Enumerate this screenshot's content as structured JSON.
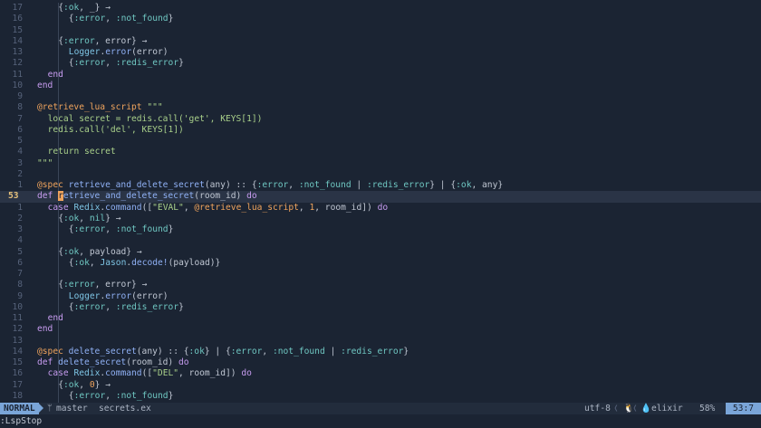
{
  "colors": {
    "background": "#1b2433",
    "current_line": "#2a3446",
    "mode_badge": "#7aa5d8",
    "keyword": "#c79cf0",
    "atom": "#6fc7c2",
    "string": "#a9d08a",
    "function": "#8fb0f4"
  },
  "lines": [
    {
      "n": "17",
      "indent": 2,
      "tokens": [
        [
          "op",
          "{"
        ],
        [
          "atom",
          ":ok"
        ],
        [
          "op",
          ", _} "
        ],
        [
          "op",
          "→"
        ]
      ]
    },
    {
      "n": "16",
      "indent": 3,
      "tokens": [
        [
          "op",
          "{"
        ],
        [
          "atom",
          ":error"
        ],
        [
          "op",
          ", "
        ],
        [
          "atom",
          ":not_found"
        ],
        [
          "op",
          "}"
        ]
      ]
    },
    {
      "n": "15",
      "indent": 0,
      "tokens": []
    },
    {
      "n": "14",
      "indent": 2,
      "tokens": [
        [
          "op",
          "{"
        ],
        [
          "atom",
          ":error"
        ],
        [
          "op",
          ", error} "
        ],
        [
          "op",
          "→"
        ]
      ]
    },
    {
      "n": "13",
      "indent": 3,
      "tokens": [
        [
          "mod",
          "Logger"
        ],
        [
          "op",
          "."
        ],
        [
          "fn",
          "error"
        ],
        [
          "op",
          "(error)"
        ]
      ]
    },
    {
      "n": "12",
      "indent": 3,
      "tokens": [
        [
          "op",
          "{"
        ],
        [
          "atom",
          ":error"
        ],
        [
          "op",
          ", "
        ],
        [
          "atom",
          ":redis_error"
        ],
        [
          "op",
          "}"
        ]
      ]
    },
    {
      "n": "11",
      "indent": 1,
      "tokens": [
        [
          "kw",
          "end"
        ]
      ]
    },
    {
      "n": "10",
      "indent": 0,
      "tokens": [
        [
          "kw",
          "end"
        ]
      ]
    },
    {
      "n": "9",
      "indent": 0,
      "tokens": []
    },
    {
      "n": "8",
      "indent": 0,
      "tokens": [
        [
          "at",
          "@retrieve_lua_script"
        ],
        [
          "op",
          " "
        ],
        [
          "str",
          "\"\"\""
        ]
      ]
    },
    {
      "n": "7",
      "indent": 1,
      "tokens": [
        [
          "str",
          "local secret = redis.call('get', KEYS[1])"
        ]
      ]
    },
    {
      "n": "6",
      "indent": 1,
      "tokens": [
        [
          "str",
          "redis.call('del', KEYS[1])"
        ]
      ]
    },
    {
      "n": "5",
      "indent": 0,
      "tokens": []
    },
    {
      "n": "4",
      "indent": 1,
      "tokens": [
        [
          "str",
          "return secret"
        ]
      ]
    },
    {
      "n": "3",
      "indent": 0,
      "tokens": [
        [
          "str",
          "\"\"\""
        ]
      ]
    },
    {
      "n": "2",
      "indent": 0,
      "tokens": []
    },
    {
      "n": "1",
      "indent": 0,
      "tokens": [
        [
          "at",
          "@spec"
        ],
        [
          "op",
          " "
        ],
        [
          "fn",
          "retrieve_and_delete_secret"
        ],
        [
          "op",
          "(any) :: {"
        ],
        [
          "atom",
          ":error"
        ],
        [
          "op",
          ", "
        ],
        [
          "atom",
          ":not_found"
        ],
        [
          "op",
          " | "
        ],
        [
          "atom",
          ":redis_error"
        ],
        [
          "op",
          "} | {"
        ],
        [
          "atom",
          ":ok"
        ],
        [
          "op",
          ", any}"
        ]
      ]
    },
    {
      "n": "53",
      "indent": 0,
      "current": true,
      "tokens": [
        [
          "kw",
          "def"
        ],
        [
          "op",
          " "
        ],
        [
          "cursor",
          "r"
        ],
        [
          "fn",
          "etrieve_and_delete_secret"
        ],
        [
          "op",
          "(room_id) "
        ],
        [
          "kw",
          "do"
        ]
      ]
    },
    {
      "n": "1",
      "indent": 1,
      "tokens": [
        [
          "kw",
          "case"
        ],
        [
          "op",
          " "
        ],
        [
          "mod",
          "Redix"
        ],
        [
          "op",
          "."
        ],
        [
          "fn",
          "command"
        ],
        [
          "op",
          "(["
        ],
        [
          "str",
          "\"EVAL\""
        ],
        [
          "op",
          ", "
        ],
        [
          "at",
          "@retrieve_lua_script"
        ],
        [
          "op",
          ", "
        ],
        [
          "num",
          "1"
        ],
        [
          "op",
          ", room_id]) "
        ],
        [
          "kw",
          "do"
        ]
      ]
    },
    {
      "n": "2",
      "indent": 2,
      "tokens": [
        [
          "op",
          "{"
        ],
        [
          "atom",
          ":ok"
        ],
        [
          "op",
          ", "
        ],
        [
          "atom",
          "nil"
        ],
        [
          "op",
          "} "
        ],
        [
          "op",
          "→"
        ]
      ]
    },
    {
      "n": "3",
      "indent": 3,
      "tokens": [
        [
          "op",
          "{"
        ],
        [
          "atom",
          ":error"
        ],
        [
          "op",
          ", "
        ],
        [
          "atom",
          ":not_found"
        ],
        [
          "op",
          "}"
        ]
      ]
    },
    {
      "n": "4",
      "indent": 0,
      "tokens": []
    },
    {
      "n": "5",
      "indent": 2,
      "tokens": [
        [
          "op",
          "{"
        ],
        [
          "atom",
          ":ok"
        ],
        [
          "op",
          ", payload} "
        ],
        [
          "op",
          "→"
        ]
      ]
    },
    {
      "n": "6",
      "indent": 3,
      "tokens": [
        [
          "op",
          "{"
        ],
        [
          "atom",
          ":ok"
        ],
        [
          "op",
          ", "
        ],
        [
          "mod",
          "Jason"
        ],
        [
          "op",
          "."
        ],
        [
          "fn",
          "decode!"
        ],
        [
          "op",
          "(payload)}"
        ]
      ]
    },
    {
      "n": "7",
      "indent": 0,
      "tokens": []
    },
    {
      "n": "8",
      "indent": 2,
      "tokens": [
        [
          "op",
          "{"
        ],
        [
          "atom",
          ":error"
        ],
        [
          "op",
          ", error} "
        ],
        [
          "op",
          "→"
        ]
      ]
    },
    {
      "n": "9",
      "indent": 3,
      "tokens": [
        [
          "mod",
          "Logger"
        ],
        [
          "op",
          "."
        ],
        [
          "fn",
          "error"
        ],
        [
          "op",
          "(error)"
        ]
      ]
    },
    {
      "n": "10",
      "indent": 3,
      "tokens": [
        [
          "op",
          "{"
        ],
        [
          "atom",
          ":error"
        ],
        [
          "op",
          ", "
        ],
        [
          "atom",
          ":redis_error"
        ],
        [
          "op",
          "}"
        ]
      ]
    },
    {
      "n": "11",
      "indent": 1,
      "tokens": [
        [
          "kw",
          "end"
        ]
      ]
    },
    {
      "n": "12",
      "indent": 0,
      "tokens": [
        [
          "kw",
          "end"
        ]
      ]
    },
    {
      "n": "13",
      "indent": 0,
      "tokens": []
    },
    {
      "n": "14",
      "indent": 0,
      "tokens": [
        [
          "at",
          "@spec"
        ],
        [
          "op",
          " "
        ],
        [
          "fn",
          "delete_secret"
        ],
        [
          "op",
          "(any) :: {"
        ],
        [
          "atom",
          ":ok"
        ],
        [
          "op",
          "} | {"
        ],
        [
          "atom",
          ":error"
        ],
        [
          "op",
          ", "
        ],
        [
          "atom",
          ":not_found"
        ],
        [
          "op",
          " | "
        ],
        [
          "atom",
          ":redis_error"
        ],
        [
          "op",
          "}"
        ]
      ]
    },
    {
      "n": "15",
      "indent": 0,
      "tokens": [
        [
          "kw",
          "def"
        ],
        [
          "op",
          " "
        ],
        [
          "fn",
          "delete_secret"
        ],
        [
          "op",
          "(room_id) "
        ],
        [
          "kw",
          "do"
        ]
      ]
    },
    {
      "n": "16",
      "indent": 1,
      "tokens": [
        [
          "kw",
          "case"
        ],
        [
          "op",
          " "
        ],
        [
          "mod",
          "Redix"
        ],
        [
          "op",
          "."
        ],
        [
          "fn",
          "command"
        ],
        [
          "op",
          "(["
        ],
        [
          "str",
          "\"DEL\""
        ],
        [
          "op",
          ", room_id]) "
        ],
        [
          "kw",
          "do"
        ]
      ]
    },
    {
      "n": "17",
      "indent": 2,
      "tokens": [
        [
          "op",
          "{"
        ],
        [
          "atom",
          ":ok"
        ],
        [
          "op",
          ", "
        ],
        [
          "num",
          "0"
        ],
        [
          "op",
          "} "
        ],
        [
          "op",
          "→"
        ]
      ]
    },
    {
      "n": "18",
      "indent": 3,
      "tokens": [
        [
          "op",
          "{"
        ],
        [
          "atom",
          ":error"
        ],
        [
          "op",
          ", "
        ],
        [
          "atom",
          ":not_found"
        ],
        [
          "op",
          "}"
        ]
      ]
    }
  ],
  "statusbar": {
    "mode": "NORMAL",
    "branch_icon": "git-branch-icon",
    "branch": "master",
    "filename": "secrets.ex",
    "encoding": "utf-8",
    "os_icon": "linux-icon",
    "filetype_icon": "elixir-drop-icon",
    "filetype": "elixir",
    "percent": "58%",
    "position": "53:7"
  },
  "cmdline": ":LspStop"
}
